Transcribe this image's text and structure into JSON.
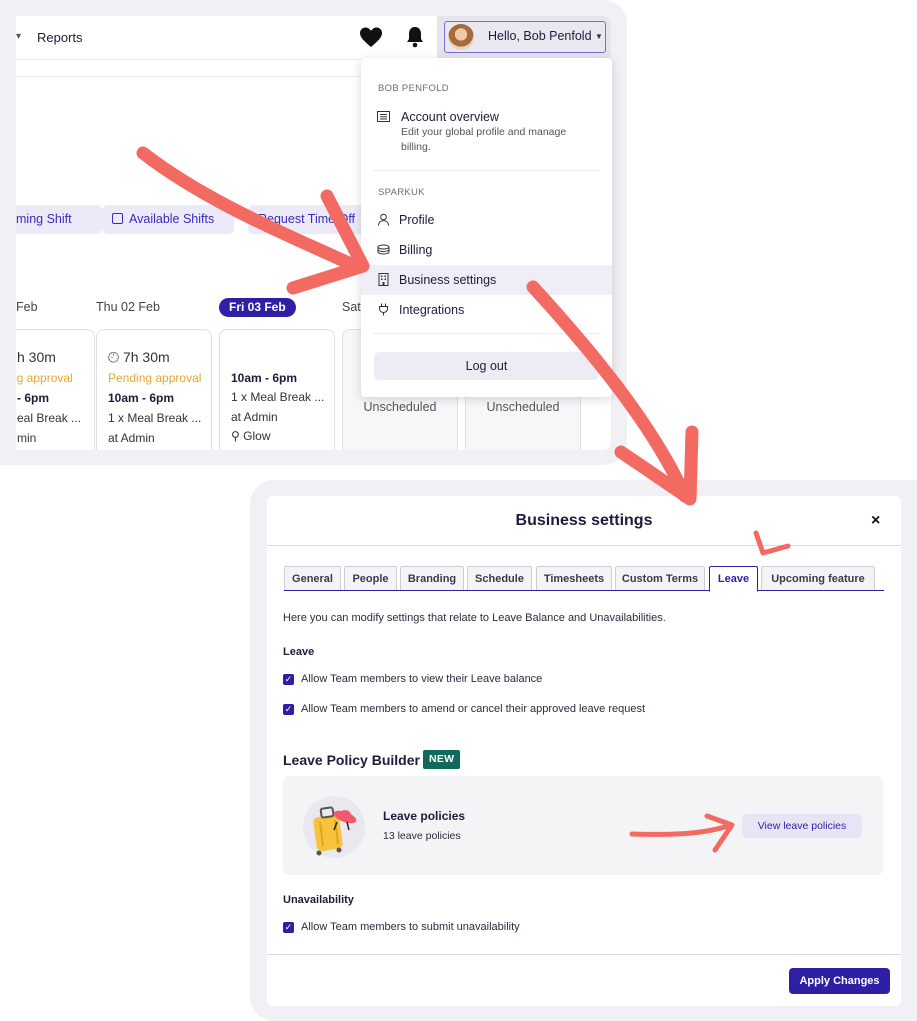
{
  "topbar": {
    "nav_reports": "Reports",
    "user_greeting": "Hello, Bob Penfold"
  },
  "actions": {
    "upcoming_shift": "ming Shift",
    "available_shifts": "Available Shifts",
    "request_time_off": "Request Time Off"
  },
  "week": {
    "days": [
      {
        "label": "Feb"
      },
      {
        "label": "Thu 02 Feb"
      },
      {
        "label": "Fri 03 Feb"
      },
      {
        "label": "Sat"
      }
    ],
    "cards": [
      {
        "duration": "h 30m",
        "status": "ng approval",
        "time": "- 6pm",
        "break": "eal Break ...",
        "location": "min"
      },
      {
        "duration": "7h 30m",
        "status": "Pending approval",
        "time": "10am - 6pm",
        "break": "1 x Meal Break ...",
        "location": "at Admin"
      },
      {
        "time": "10am - 6pm",
        "break": "1 x Meal Break ...",
        "location": "at Admin",
        "site": "Glow"
      },
      {
        "unscheduled": "Unscheduled"
      },
      {
        "unscheduled": "Unscheduled"
      }
    ]
  },
  "dropdown": {
    "section_user": "BOB PENFOLD",
    "account_overview": "Account overview",
    "account_desc": "Edit your global profile and manage billing.",
    "section_org": "SPARKUK",
    "items": [
      {
        "label": "Profile",
        "icon": "person-icon"
      },
      {
        "label": "Billing",
        "icon": "billing-icon"
      },
      {
        "label": "Business settings",
        "icon": "building-icon"
      },
      {
        "label": "Integrations",
        "icon": "plug-icon"
      }
    ],
    "logout": "Log out"
  },
  "dialog": {
    "title": "Business settings",
    "close": "×",
    "tabs": [
      "General",
      "People",
      "Branding",
      "Schedule",
      "Timesheets",
      "Custom Terms",
      "Leave",
      "Upcoming feature"
    ],
    "active_tab": "Leave",
    "intro": "Here you can modify settings that relate to Leave Balance and Unavailabilities.",
    "leave_heading": "Leave",
    "leave_options": [
      "Allow Team members to view their Leave balance",
      "Allow Team members to amend or cancel their approved leave request"
    ],
    "lpb_title": "Leave Policy Builder",
    "new_badge": "NEW",
    "policies_title": "Leave policies",
    "policies_count": "13 leave policies",
    "view_policies": "View leave policies",
    "unavailability_heading": "Unavailability",
    "unavailability_option": "Allow Team members to submit unavailability",
    "apply": "Apply Changes"
  },
  "colors": {
    "brand": "#2f1fa5",
    "pending": "#e7a72a",
    "new_badge": "#0f6a5d",
    "annotation_arrow": "#f36a62"
  }
}
